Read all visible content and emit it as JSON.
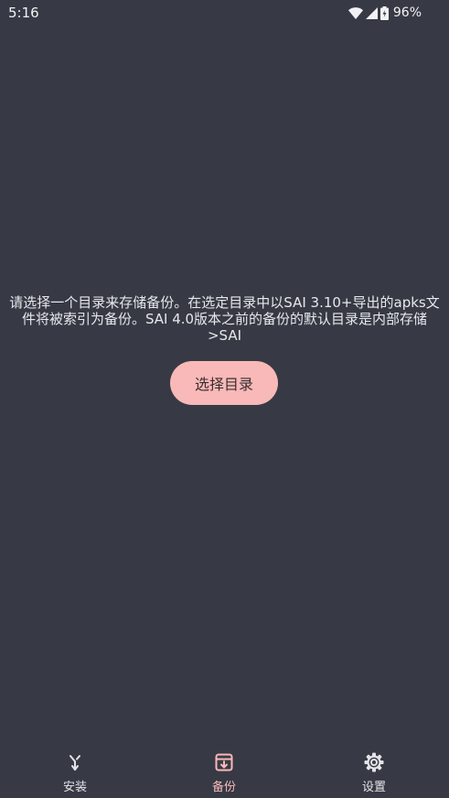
{
  "status_bar": {
    "time": "5:16",
    "battery_percent": "96%",
    "icons": [
      "wifi-icon",
      "cell-signal-icon",
      "battery-icon"
    ]
  },
  "main": {
    "message": "请选择一个目录来存储备份。在选定目录中以SAI 3.10+导出的apks文件将被索引为备份。SAI 4.0版本之前的备份的默认目录是内部存储>SAI",
    "choose_button_label": "选择目录"
  },
  "bottom_nav": {
    "items": [
      {
        "label": "安装",
        "icon": "install-icon",
        "active": false
      },
      {
        "label": "备份",
        "icon": "backup-icon",
        "active": true
      },
      {
        "label": "设置",
        "icon": "gear-icon",
        "active": false
      }
    ]
  },
  "colors": {
    "background": "#373a45",
    "accent": "#f8b9b8",
    "text": "#e7e8ec"
  }
}
